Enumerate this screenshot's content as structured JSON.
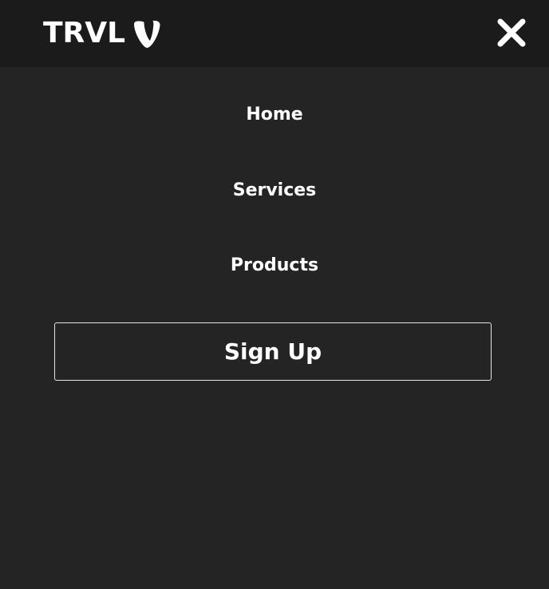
{
  "header": {
    "logo_text": "TRVL",
    "logo_icon": "typo3-shield-icon",
    "close_icon": "close-icon"
  },
  "nav": {
    "items": [
      {
        "label": "Home"
      },
      {
        "label": "Services"
      },
      {
        "label": "Products"
      }
    ],
    "signup_label": "Sign Up"
  },
  "colors": {
    "background": "#252425",
    "topbar": "#1b1b1b",
    "text": "#ffffff",
    "button_border": "#e6e6e6"
  }
}
